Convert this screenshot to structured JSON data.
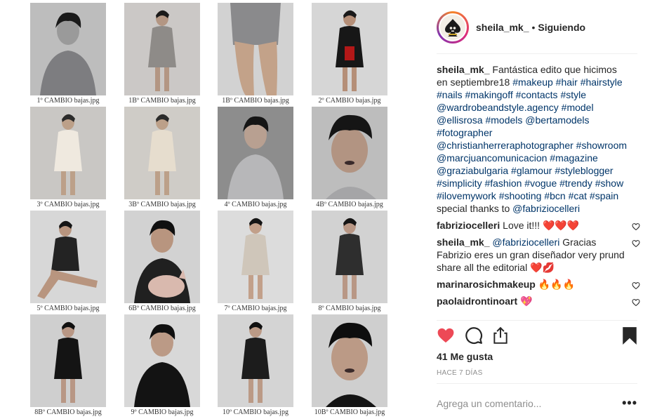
{
  "sheet": {
    "captions": [
      "1º CAMBIO bajas.jpg",
      "1Bº CAMBIO bajas.jpg",
      "1Bº CAMBIO bajas.jpg",
      "2º CAMBIO bajas.jpg",
      "3º CAMBIO bajas.jpg",
      "3Bº CAMBIO bajas.jpg",
      "4º CAMBIO bajas.jpg",
      "4Bº CAMBIO bajas.jpg",
      "5º CAMBIO bajas.jpg",
      "6Bº CAMBIO bajas.jpg",
      "7º CAMBIO bajas.jpg",
      "8º CAMBIO bajas.jpg",
      "8Bº CAMBIO bajas.jpg",
      "9º CAMBIO bajas.jpg",
      "10º CAMBIO bajas.jpg",
      "10Bº CAMBIO bajas.jpg"
    ]
  },
  "header": {
    "username": "sheila_mk_",
    "separator": "•",
    "follow_status": "Siguiendo"
  },
  "caption": {
    "username": "sheila_mk_",
    "parts": [
      {
        "text": " Fantástica edito que hicimos en septiembre18 ",
        "tag": false
      },
      {
        "text": "#makeup",
        "tag": true
      },
      {
        "text": " ",
        "tag": false
      },
      {
        "text": "#hair",
        "tag": true
      },
      {
        "text": " ",
        "tag": false
      },
      {
        "text": "#hairstyle",
        "tag": true
      },
      {
        "text": " ",
        "tag": false
      },
      {
        "text": "#nails",
        "tag": true
      },
      {
        "text": " ",
        "tag": false
      },
      {
        "text": "#makingoff",
        "tag": true
      },
      {
        "text": " ",
        "tag": false
      },
      {
        "text": "#contacts",
        "tag": true
      },
      {
        "text": " ",
        "tag": false
      },
      {
        "text": "#style",
        "tag": true
      },
      {
        "text": " ",
        "tag": false
      },
      {
        "text": "@wardrobeandstyle.agency",
        "tag": true
      },
      {
        "text": " ",
        "tag": false
      },
      {
        "text": "#model",
        "tag": true
      },
      {
        "text": " ",
        "tag": false
      },
      {
        "text": "@ellisrosa",
        "tag": true
      },
      {
        "text": " ",
        "tag": false
      },
      {
        "text": "#models",
        "tag": true
      },
      {
        "text": " ",
        "tag": false
      },
      {
        "text": "@bertamodels",
        "tag": true
      },
      {
        "text": " ",
        "tag": false
      },
      {
        "text": "#fotographer",
        "tag": true
      },
      {
        "text": " ",
        "tag": false
      },
      {
        "text": "@christianherreraphotographer",
        "tag": true
      },
      {
        "text": " ",
        "tag": false
      },
      {
        "text": "#showroom",
        "tag": true
      },
      {
        "text": " ",
        "tag": false
      },
      {
        "text": "@marcjuancomunicacion",
        "tag": true
      },
      {
        "text": " ",
        "tag": false
      },
      {
        "text": "#magazine",
        "tag": true
      },
      {
        "text": " ",
        "tag": false
      },
      {
        "text": "@graziabulgaria",
        "tag": true
      },
      {
        "text": " ",
        "tag": false
      },
      {
        "text": "#glamour",
        "tag": true
      },
      {
        "text": " ",
        "tag": false
      },
      {
        "text": "#styleblogger",
        "tag": true
      },
      {
        "text": " ",
        "tag": false
      },
      {
        "text": "#simplicity",
        "tag": true
      },
      {
        "text": " ",
        "tag": false
      },
      {
        "text": "#fashion",
        "tag": true
      },
      {
        "text": " ",
        "tag": false
      },
      {
        "text": "#vogue",
        "tag": true
      },
      {
        "text": " ",
        "tag": false
      },
      {
        "text": "#trendy",
        "tag": true
      },
      {
        "text": " ",
        "tag": false
      },
      {
        "text": "#show",
        "tag": true
      },
      {
        "text": " ",
        "tag": false
      },
      {
        "text": "#ilovemywork",
        "tag": true
      },
      {
        "text": " ",
        "tag": false
      },
      {
        "text": "#shooting",
        "tag": true
      },
      {
        "text": " ",
        "tag": false
      },
      {
        "text": "#bcn",
        "tag": true
      },
      {
        "text": " ",
        "tag": false
      },
      {
        "text": "#cat",
        "tag": true
      },
      {
        "text": " ",
        "tag": false
      },
      {
        "text": "#spain",
        "tag": true
      },
      {
        "text": " special thanks to ",
        "tag": false
      },
      {
        "text": "@fabriziocelleri",
        "tag": true
      }
    ]
  },
  "comments": [
    {
      "username": "fabriziocelleri",
      "parts": [
        {
          "text": " Love it!!! ",
          "tag": false
        },
        {
          "text": "❤️❤️❤️",
          "tag": false
        }
      ]
    },
    {
      "username": "sheila_mk_",
      "parts": [
        {
          "text": " ",
          "tag": false
        },
        {
          "text": "@fabriziocelleri",
          "tag": true
        },
        {
          "text": " Gracias Fabrizio eres un gran diseñador very prund share all the editorial ",
          "tag": false
        },
        {
          "text": "❤️💋",
          "tag": false
        }
      ]
    },
    {
      "username": "marinarosichmakeup",
      "parts": [
        {
          "text": " 🔥🔥🔥",
          "tag": false
        }
      ]
    },
    {
      "username": "paolaidrontinoart",
      "parts": [
        {
          "text": " 💖",
          "tag": false
        }
      ]
    }
  ],
  "icons": {
    "like": "heart-filled-icon",
    "comment": "comment-bubble-icon",
    "share": "share-upload-icon",
    "save": "bookmark-filled-icon",
    "comment_like": "heart-outline-icon",
    "more": "more-options-icon"
  },
  "colors": {
    "like_red": "#ed4956",
    "tag_blue": "#003569",
    "muted": "#8e8e8e"
  },
  "likes": "41 Me gusta",
  "timestamp": "HACE 7 DÍAS",
  "add_comment": {
    "placeholder": "Agrega un comentario...",
    "more": "•••"
  }
}
